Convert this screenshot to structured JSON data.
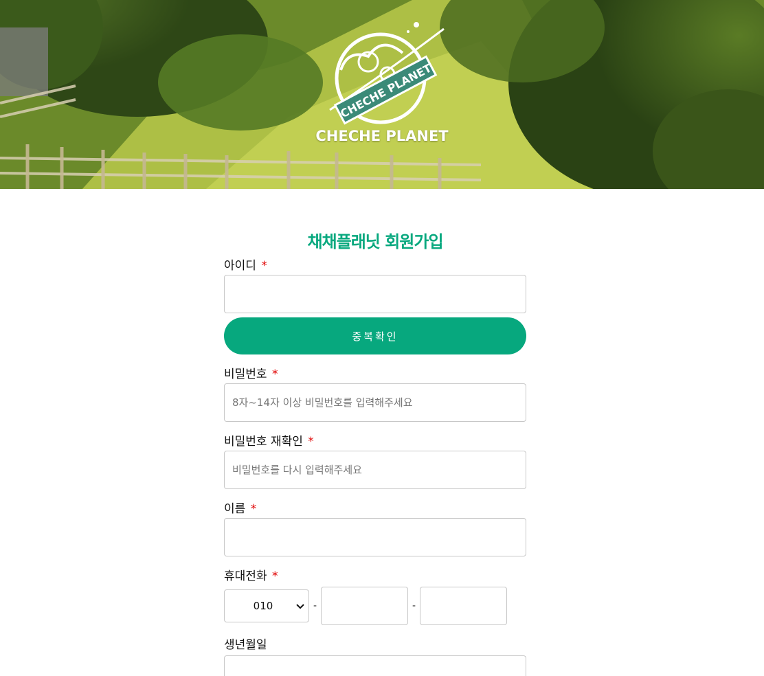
{
  "hero": {
    "brand": "CHECHE PLANET",
    "logo_text": "CHECHE PLANET"
  },
  "form": {
    "title": "채채플래닛 회원가입",
    "required_mark": "*",
    "userid": {
      "label": "아이디",
      "value": "",
      "placeholder": ""
    },
    "dup_check_button": "중복확인",
    "password": {
      "label": "비밀번호",
      "placeholder": "8자~14자 이상 비밀번호를 입력해주세요"
    },
    "password_confirm": {
      "label": "비밀번호 재확인",
      "placeholder": "비밀번호를 다시 입력해주세요"
    },
    "name": {
      "label": "이름",
      "value": ""
    },
    "phone": {
      "label": "휴대전화",
      "prefix_selected": "010",
      "separator": "-",
      "middle": "",
      "last": ""
    },
    "birth": {
      "label": "생년월일"
    }
  },
  "colors": {
    "accent": "#07a87e",
    "required": "#e00000",
    "border": "#c7c7c7"
  },
  "icons": {
    "select_arrow": "chevron-down-icon"
  }
}
